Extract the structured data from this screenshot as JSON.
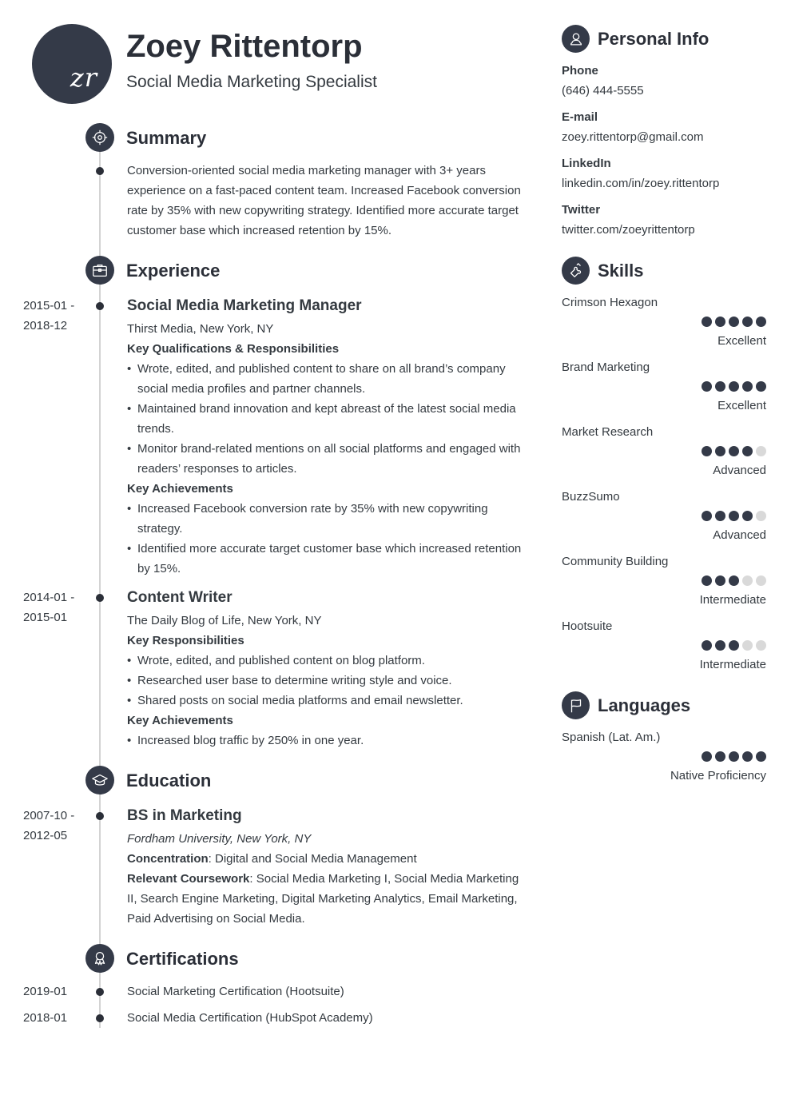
{
  "header": {
    "initials": "zr",
    "name": "Zoey Rittentorp",
    "title": "Social Media Marketing Specialist"
  },
  "sections": {
    "summary": {
      "title": "Summary",
      "icon": "target-icon",
      "text": "Conversion-oriented social media marketing manager with 3+ years experience on a fast-paced content team. Increased Facebook conversion rate by 35% with new copywriting strategy. Identified more accurate target customer base which increased retention by 15%."
    },
    "experience": {
      "title": "Experience",
      "icon": "briefcase-icon",
      "jobs": [
        {
          "date_start": "2015-01 -",
          "date_end": "2018-12",
          "title": "Social Media Marketing Manager",
          "company": "Thirst Media, New York, NY",
          "resp_heading": "Key Qualifications & Responsibilities",
          "responsibilities": [
            "Wrote, edited, and published content to share on all brand’s company social media profiles and partner channels.",
            "Maintained brand innovation and kept abreast of the latest social media trends.",
            "Monitor brand-related mentions on all social platforms and engaged with readers’ responses to articles."
          ],
          "ach_heading": "Key Achievements",
          "achievements": [
            "Increased Facebook conversion rate by 35% with new copywriting strategy.",
            "Identified more accurate target customer base which increased retention by 15%."
          ]
        },
        {
          "date_start": "2014-01 -",
          "date_end": "2015-01",
          "title": "Content Writer",
          "company": "The Daily Blog of Life, New York, NY",
          "resp_heading": "Key Responsibilities",
          "responsibilities": [
            "Wrote, edited, and published content on blog platform.",
            "Researched user base to determine writing style and voice.",
            "Shared posts on social media platforms and email newsletter."
          ],
          "ach_heading": "Key Achievements",
          "achievements": [
            "Increased blog traffic by 250% in one year."
          ]
        }
      ]
    },
    "education": {
      "title": "Education",
      "icon": "graduation-cap-icon",
      "items": [
        {
          "date_start": "2007-10 -",
          "date_end": "2012-05",
          "degree": "BS in Marketing",
          "school": "Fordham University, New York, NY",
          "concentration_label": "Concentration",
          "concentration": ": Digital and Social Media Management",
          "coursework_label": "Relevant Coursework",
          "coursework": ": Social Media Marketing I, Social Media Marketing II, Search Engine Marketing, Digital Marketing Analytics, Email Marketing, Paid Advertising on Social Media."
        }
      ]
    },
    "certifications": {
      "title": "Certifications",
      "icon": "award-ribbon-icon",
      "items": [
        {
          "date": "2019-01",
          "name": "Social Marketing Certification (Hootsuite)"
        },
        {
          "date": "2018-01",
          "name": "Social Media Certification (HubSpot Academy)"
        }
      ]
    }
  },
  "sidebar": {
    "personal_info": {
      "title": "Personal Info",
      "icon": "user-icon",
      "fields": [
        {
          "label": "Phone",
          "value": "(646) 444-5555"
        },
        {
          "label": "E-mail",
          "value": "zoey.rittentorp@gmail.com"
        },
        {
          "label": "LinkedIn",
          "value": "linkedin.com/in/zoey.rittentorp"
        },
        {
          "label": "Twitter",
          "value": "twitter.com/zoeyrittentorp"
        }
      ]
    },
    "skills": {
      "title": "Skills",
      "icon": "puzzle-piece-icon",
      "items": [
        {
          "name": "Crimson Hexagon",
          "rating": 5,
          "max": 5,
          "level": "Excellent"
        },
        {
          "name": "Brand Marketing",
          "rating": 5,
          "max": 5,
          "level": "Excellent"
        },
        {
          "name": "Market Research",
          "rating": 4,
          "max": 5,
          "level": "Advanced"
        },
        {
          "name": "BuzzSumo",
          "rating": 4,
          "max": 5,
          "level": "Advanced"
        },
        {
          "name": "Community Building",
          "rating": 3,
          "max": 5,
          "level": "Intermediate"
        },
        {
          "name": "Hootsuite",
          "rating": 3,
          "max": 5,
          "level": "Intermediate"
        }
      ]
    },
    "languages": {
      "title": "Languages",
      "icon": "flag-icon",
      "items": [
        {
          "name": "Spanish (Lat. Am.)",
          "rating": 5,
          "max": 5,
          "level": "Native Proficiency"
        }
      ]
    }
  },
  "colors": {
    "accent": "#343a48",
    "text": "#343a40",
    "timeline": "#d3d3d3",
    "rating_off": "#d9d9d9"
  }
}
